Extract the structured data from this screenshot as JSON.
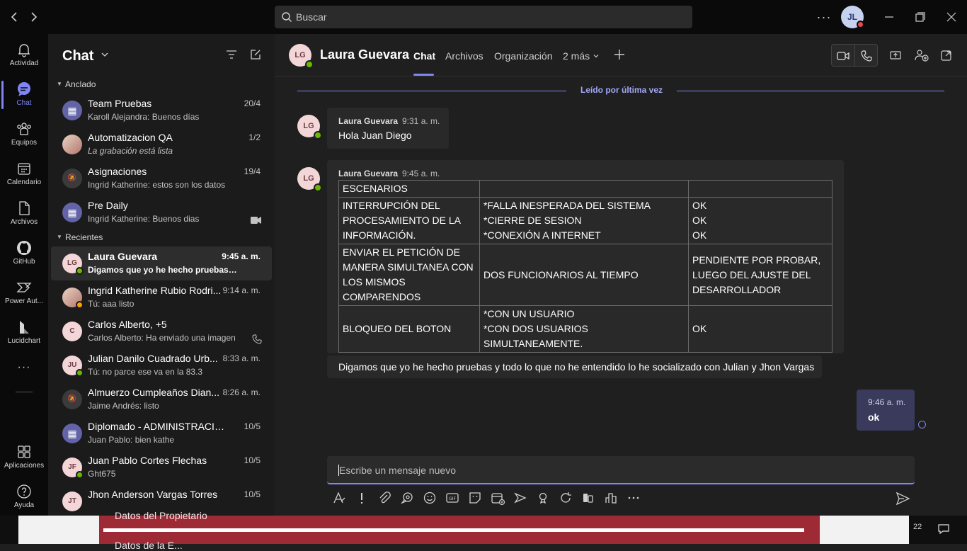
{
  "titlebar": {
    "search_placeholder": "Buscar",
    "user_initials": "JL",
    "more": "···"
  },
  "rail": [
    {
      "label": "Actividad",
      "icon": "bell-icon"
    },
    {
      "label": "Chat",
      "icon": "chat-icon",
      "active": true
    },
    {
      "label": "Equipos",
      "icon": "teams-icon"
    },
    {
      "label": "Calendario",
      "icon": "calendar-icon"
    },
    {
      "label": "Archivos",
      "icon": "file-icon"
    },
    {
      "label": "GitHub",
      "icon": "github-icon"
    },
    {
      "label": "Power Aut...",
      "icon": "power-automate-icon"
    },
    {
      "label": "Lucidchart",
      "icon": "lucidchart-icon"
    },
    {
      "label": "···",
      "icon": "more-icon"
    },
    {
      "label": "Aplicaciones",
      "icon": "apps-icon"
    },
    {
      "label": "Ayuda",
      "icon": "help-icon"
    }
  ],
  "chatlist": {
    "title": "Chat",
    "pinned_label": "Anclado",
    "recent_label": "Recientes",
    "pinned": [
      {
        "initials": "▦",
        "name": "Team Pruebas",
        "preview": "Karoll Alejandra: Buenos días",
        "time": "20/4",
        "kind": "group"
      },
      {
        "initials": "",
        "name": "Automatizacion QA",
        "preview": "La grabación está lista",
        "time": "1/2",
        "kind": "pic",
        "italic": true
      },
      {
        "initials": "🔕",
        "name": "Asignaciones",
        "preview": "Ingrid Katherine: estos son los datos",
        "time": "19/4",
        "kind": "muted"
      },
      {
        "initials": "▦",
        "name": "Pre Daily",
        "preview": "Ingrid Katherine: Buenos dias",
        "time": "",
        "kind": "group",
        "right_icon": "video-icon"
      }
    ],
    "recent": [
      {
        "initials": "LG",
        "name": "Laura Guevara",
        "preview": "Digamos que yo he hecho pruebas y t...",
        "time": "9:45 a. m.",
        "kind": "person",
        "status": "#6bb700",
        "selected": true
      },
      {
        "initials": "",
        "name": "Ingrid Katherine Rubio Rodri...",
        "preview": "Tú: aaa listo",
        "time": "9:14 a. m.",
        "kind": "pic",
        "status": "#f8a100"
      },
      {
        "initials": "C",
        "name": "Carlos Alberto, +5",
        "preview": "Carlos Alberto: Ha enviado una imagen",
        "time": "",
        "kind": "person",
        "right_icon": "phone-icon"
      },
      {
        "initials": "JU",
        "name": "Julian Danilo Cuadrado Urb...",
        "preview": "Tú: no parce ese va en la 83.3",
        "time": "8:33 a. m.",
        "kind": "person",
        "status": "#6bb700"
      },
      {
        "initials": "🔕",
        "name": "Almuerzo Cumpleaños Dian...",
        "preview": "Jaime Andrés: listo",
        "time": "8:26 a. m.",
        "kind": "muted"
      },
      {
        "initials": "▦",
        "name": "Diplomado - ADMINISTRACIÓN ...",
        "preview": "Juan Pablo: bien kathe",
        "time": "10/5",
        "kind": "group"
      },
      {
        "initials": "JF",
        "name": "Juan Pablo Cortes Flechas",
        "preview": "Ght675",
        "time": "10/5",
        "kind": "person",
        "status": "#6bb700"
      },
      {
        "initials": "JT",
        "name": "Jhon Anderson Vargas Torres",
        "preview": "",
        "time": "10/5",
        "kind": "person"
      }
    ]
  },
  "main": {
    "contact_initials": "LG",
    "contact_name": "Laura Guevara",
    "tabs": [
      "Chat",
      "Archivos",
      "Organización",
      "2 más"
    ],
    "read_label": "Leído por última vez",
    "msg1": {
      "author": "Laura Guevara",
      "time": "9:31 a. m.",
      "text": "Hola Juan Diego"
    },
    "msg2": {
      "author": "Laura Guevara",
      "time": "9:45 a. m."
    },
    "table": [
      [
        "ESCENARIOS",
        "",
        ""
      ],
      [
        "INTERRUPCIÓN DEL\nPROCESAMIENTO DE LA\nINFORMACIÓN.",
        "*FALLA INESPERADA DEL SISTEMA\n*CIERRE DE SESION\n*CONEXIÓN A INTERNET",
        "OK\nOK\nOK"
      ],
      [
        "ENVIAR EL PETICIÓN DE\nMANERA SIMULTANEA CON\nLOS MISMOS\nCOMPARENDOS",
        "DOS FUNCIONARIOS AL TIEMPO",
        "PENDIENTE POR PROBAR,\nLUEGO DEL AJUSTE DEL\nDESARROLLADOR"
      ],
      [
        "BLOQUEO DEL BOTON",
        "*CON UN USUARIO\n*CON DOS USUARIOS\nSIMULTANEAMENTE.",
        "OK"
      ]
    ],
    "msg3_text": "Digamos que yo he hecho pruebas y todo lo que no he entendido lo he socializado con Julian y Jhon Vargas",
    "mine": {
      "time": "9:46 a. m.",
      "text": "ok"
    },
    "compose_placeholder": "Escribe un mensaje nuevo"
  },
  "taskbar": {
    "bg_line1": "Datos del Propietario",
    "bg_line2": "Datos de la E...",
    "tray_text": "22"
  }
}
